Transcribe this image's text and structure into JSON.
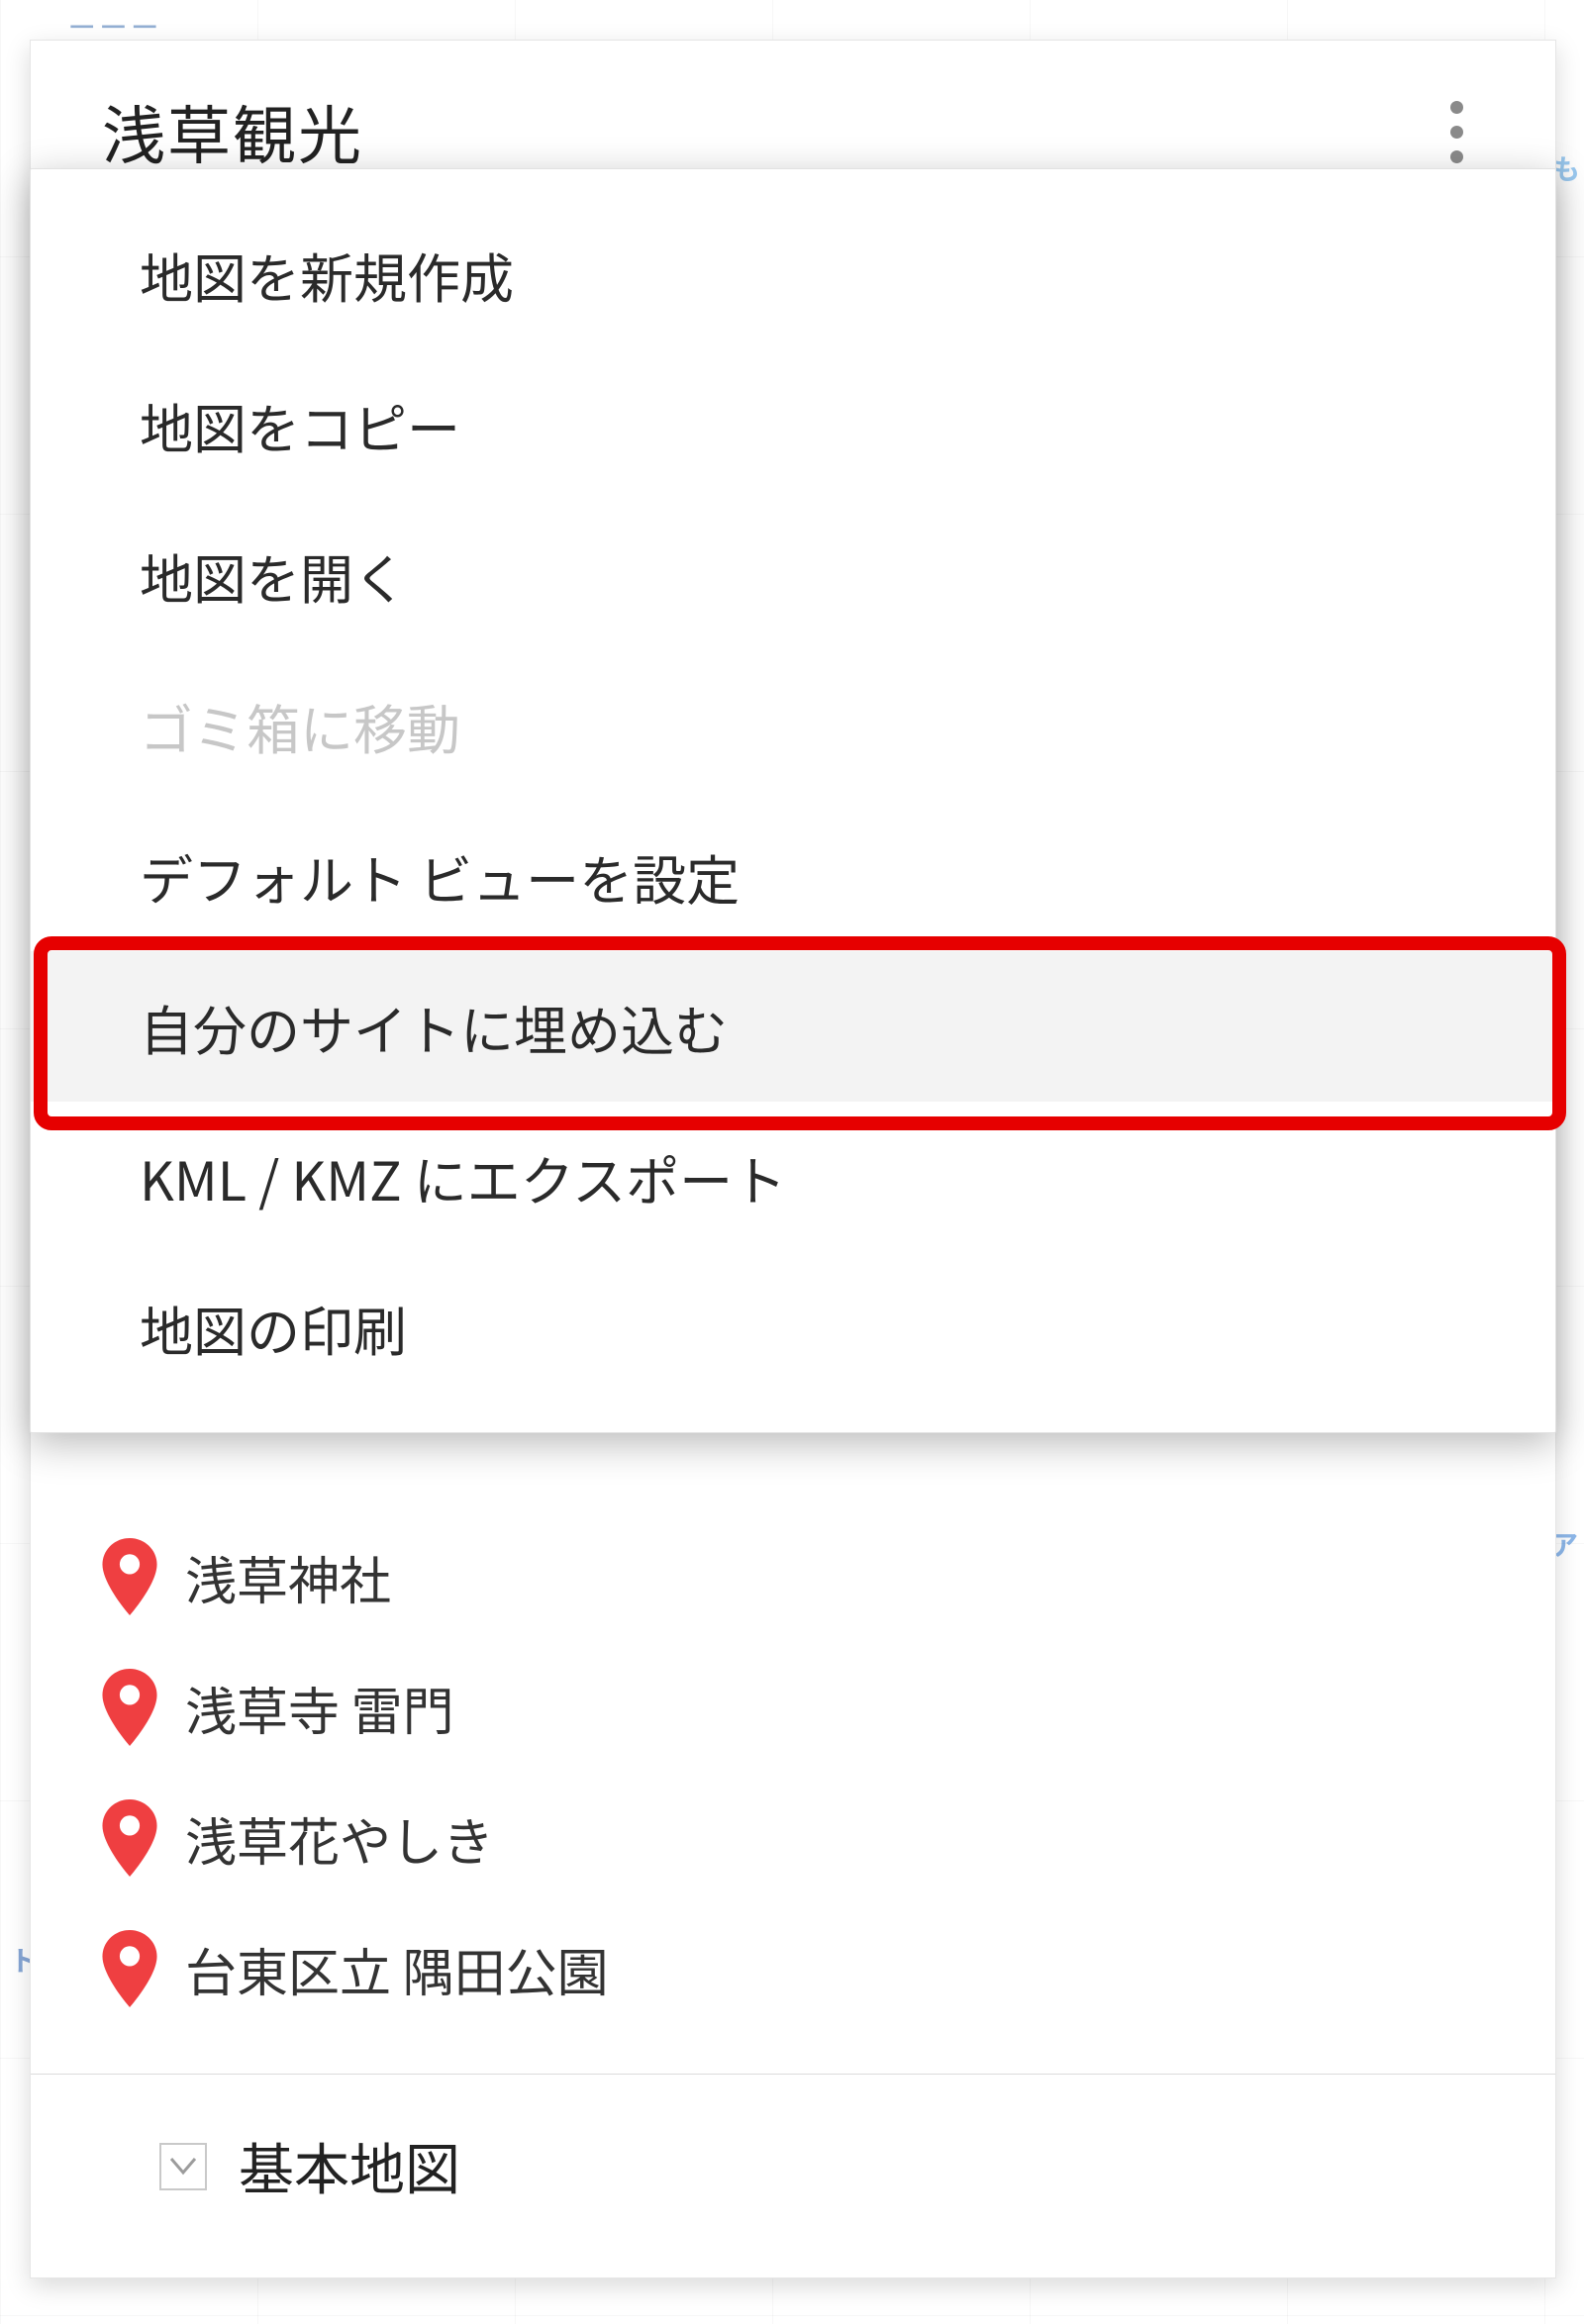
{
  "panel": {
    "title": "浅草観光"
  },
  "menu": {
    "items": [
      {
        "label": "地図を新規作成",
        "disabled": false
      },
      {
        "label": "地図をコピー",
        "disabled": false
      },
      {
        "label": "地図を開く",
        "disabled": false
      },
      {
        "label": "ゴミ箱に移動",
        "disabled": true
      },
      {
        "label": "デフォルト ビューを設定",
        "disabled": false
      },
      {
        "label": "自分のサイトに埋め込む",
        "disabled": false,
        "highlighted": true
      },
      {
        "label": "KML / KMZ にエクスポート",
        "disabled": false
      },
      {
        "label": "地図の印刷",
        "disabled": false
      }
    ]
  },
  "places": [
    {
      "label": "浅草神社"
    },
    {
      "label": "浅草寺 雷門"
    },
    {
      "label": "浅草花やしき"
    },
    {
      "label": "台東区立 隅田公園"
    }
  ],
  "basemap": {
    "label": "基本地図"
  },
  "colors": {
    "highlight": "#e60000",
    "pin": "#ef3f41"
  }
}
